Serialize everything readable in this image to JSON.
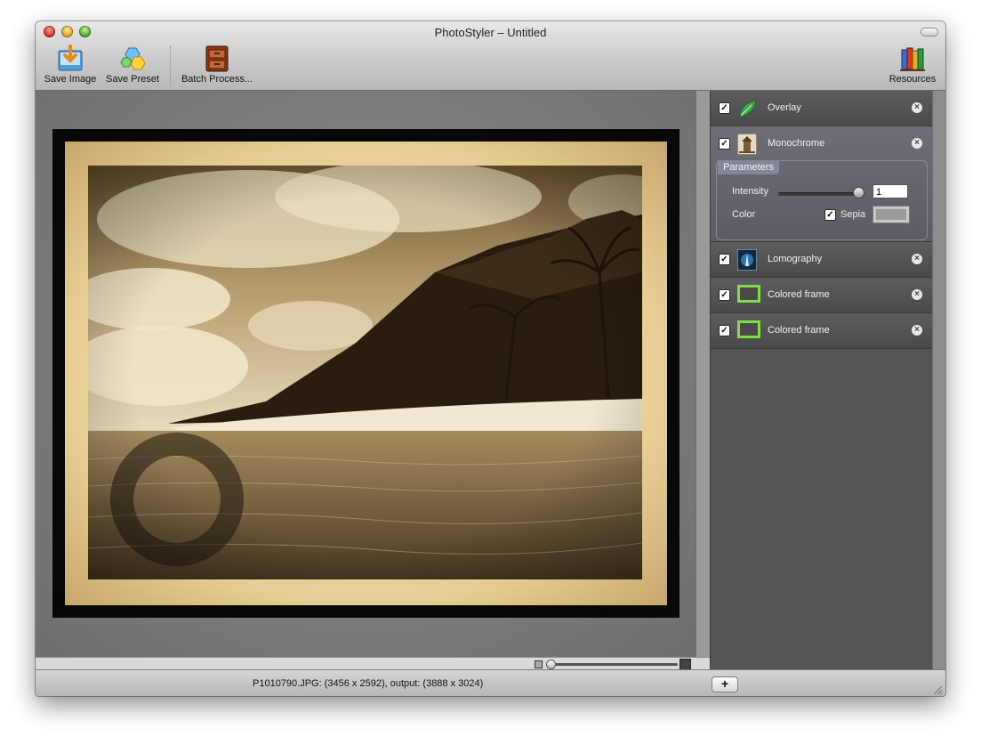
{
  "window": {
    "title": "PhotoStyler – Untitled"
  },
  "toolbar": {
    "save_image": "Save Image",
    "save_preset": "Save Preset",
    "batch_process": "Batch Process...",
    "resources": "Resources"
  },
  "effects": [
    {
      "label": "Overlay",
      "enabled": true,
      "icon": "leaf-icon"
    },
    {
      "label": "Monochrome",
      "enabled": true,
      "icon": "monochrome-thumb-icon"
    },
    {
      "label": "Lomography",
      "enabled": true,
      "icon": "lomography-thumb-icon"
    },
    {
      "label": "Colored frame",
      "enabled": true,
      "icon": "green-frame-icon"
    },
    {
      "label": "Colored frame",
      "enabled": true,
      "icon": "green-frame-icon"
    }
  ],
  "parameters": {
    "title": "Parameters",
    "intensity_label": "Intensity",
    "intensity_value": "1",
    "color_label": "Color",
    "sepia_label": "Sepia",
    "sepia_checked": true
  },
  "status": {
    "text": "P1010790.JPG: (3456 x 2592), output: (3888 x 3024)",
    "add_label": "+"
  },
  "colors": {
    "panel_bg": "#555555",
    "sepia_light": "#f2e6c4",
    "sepia_dark": "#3a2a14",
    "frame_green": "#7fdc4a"
  }
}
